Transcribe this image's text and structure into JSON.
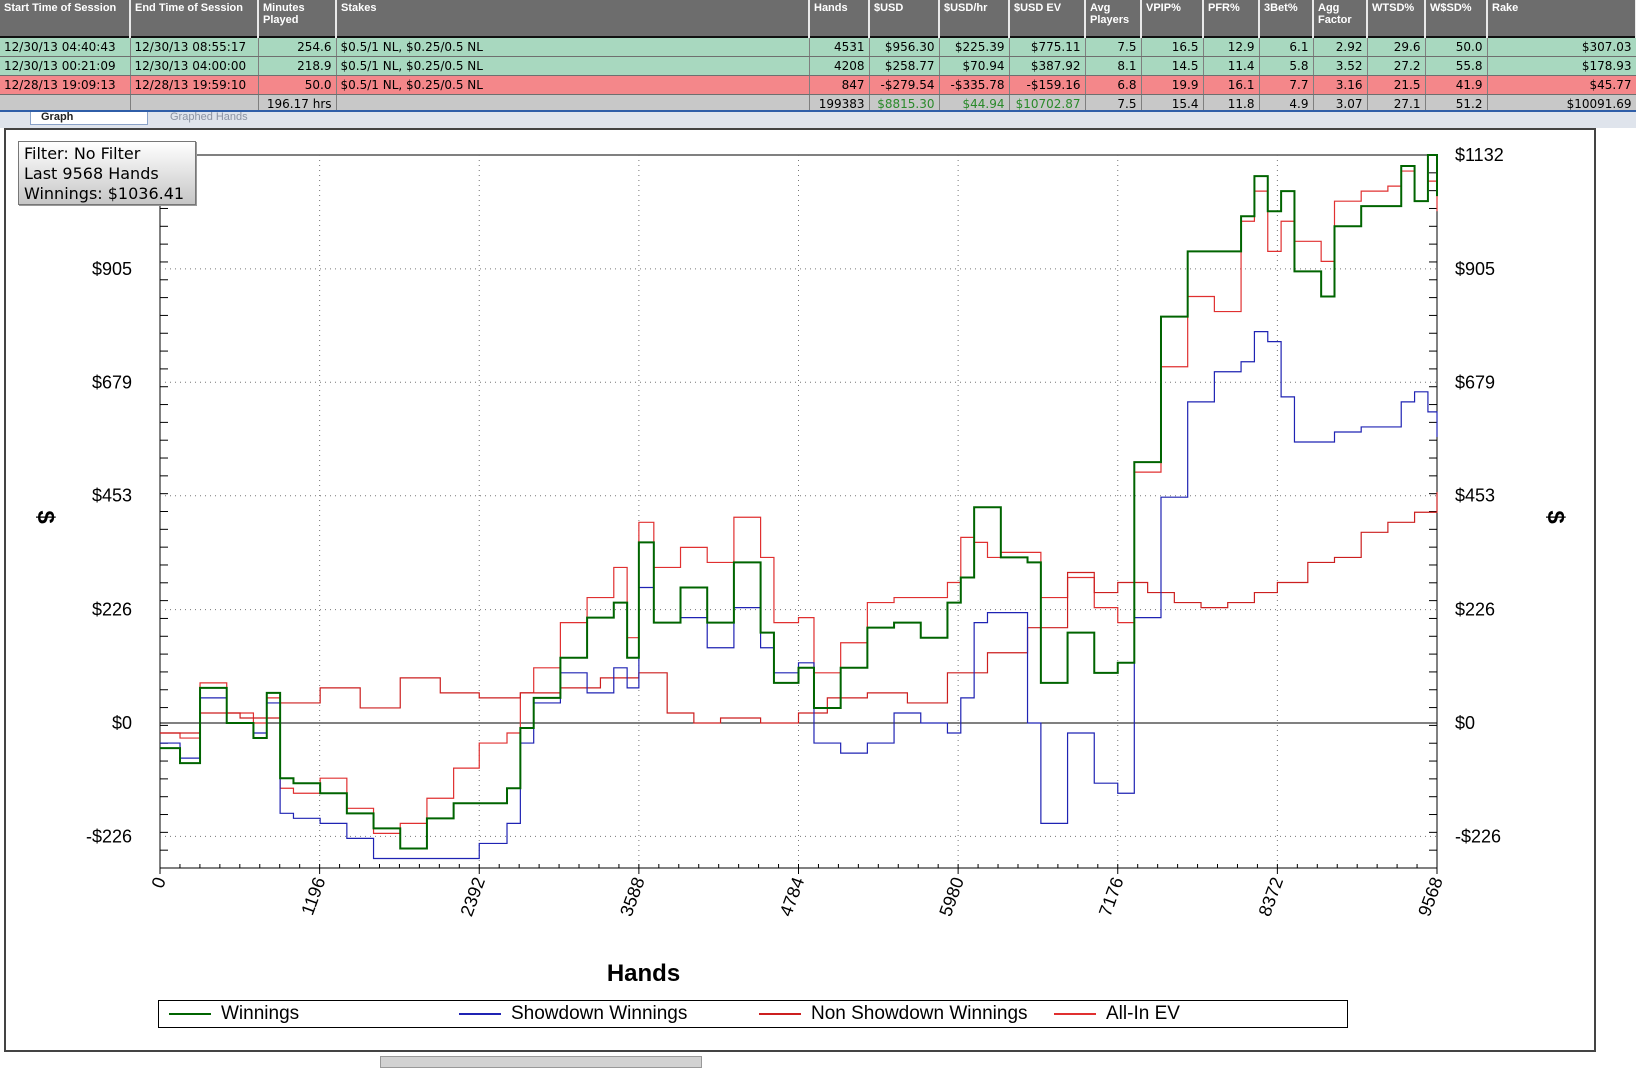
{
  "stats_table": {
    "columns": [
      "Start Time of Session",
      "End Time of Session",
      "Minutes Played",
      "Stakes",
      "Hands",
      "$USD",
      "$USD/hr",
      "$USD EV",
      "Avg Players",
      "VPIP%",
      "PFR%",
      "3Bet%",
      "Agg Factor",
      "WTSD%",
      "W$SD%",
      "Rake"
    ],
    "rows": [
      [
        "12/30/13 04:40:43",
        "12/30/13 08:55:17",
        "254.6",
        "$0.5/1 NL, $0.25/0.5 NL",
        "4531",
        "$956.30",
        "$225.39",
        "$775.11",
        "7.5",
        "16.5",
        "12.9",
        "6.1",
        "2.92",
        "29.6",
        "50.0",
        "$307.03"
      ],
      [
        "12/30/13 00:21:09",
        "12/30/13 04:00:00",
        "218.9",
        "$0.5/1 NL, $0.25/0.5 NL",
        "4208",
        "$258.77",
        "$70.94",
        "$387.92",
        "8.1",
        "14.5",
        "11.4",
        "5.8",
        "3.52",
        "27.2",
        "55.8",
        "$178.93"
      ],
      [
        "12/28/13 19:09:13",
        "12/28/13 19:59:10",
        "50.0",
        "$0.5/1 NL, $0.25/0.5 NL",
        "847",
        "-$279.54",
        "-$335.78",
        "-$159.16",
        "6.8",
        "19.9",
        "16.1",
        "7.7",
        "3.16",
        "21.5",
        "41.9",
        "$45.77"
      ],
      [
        "",
        "",
        "196.17 hrs",
        "",
        "199383",
        "$8815.30",
        "$44.94",
        "$10702.87",
        "7.5",
        "15.4",
        "11.8",
        "4.9",
        "3.07",
        "27.1",
        "51.2",
        "$10091.69"
      ]
    ],
    "row_styles": [
      "sel-green",
      "green",
      "red",
      "total"
    ]
  },
  "tabs": {
    "graph": "Graph",
    "graphed_hands": "Graphed Hands"
  },
  "filter": {
    "line1": "Filter: No Filter",
    "line2": "Last  9568 Hands",
    "line3": "Winnings: $1036.41"
  },
  "chart_data": {
    "type": "line",
    "xlabel": "Hands",
    "ylabel": "$",
    "x_ticks": [
      "0",
      "1196",
      "2392",
      "3588",
      "4784",
      "5980",
      "7176",
      "8372",
      "9568"
    ],
    "y_ticks": [
      "-$226",
      "$0",
      "$226",
      "$453",
      "$679",
      "$905",
      "$1132"
    ],
    "xlim": [
      0,
      9568
    ],
    "ylim": [
      -295,
      1132
    ],
    "grid": true,
    "legend_position": "bottom",
    "series": [
      {
        "name": "Winnings",
        "color": "#006400",
        "x": [
          0,
          150,
          300,
          500,
          700,
          800,
          900,
          1000,
          1200,
          1400,
          1600,
          1800,
          2000,
          2200,
          2392,
          2600,
          2700,
          2800,
          3000,
          3200,
          3400,
          3500,
          3588,
          3700,
          3900,
          4100,
          4300,
          4500,
          4600,
          4784,
          4900,
          5100,
          5300,
          5500,
          5700,
          5900,
          6000,
          6100,
          6200,
          6300,
          6500,
          6600,
          6800,
          7000,
          7176,
          7300,
          7500,
          7700,
          7900,
          8100,
          8200,
          8300,
          8400,
          8500,
          8700,
          8800,
          9000,
          9200,
          9300,
          9400,
          9500,
          9568
        ],
        "y": [
          -50,
          -80,
          70,
          0,
          -30,
          60,
          -110,
          -120,
          -140,
          -180,
          -210,
          -250,
          -190,
          -160,
          -160,
          -130,
          -10,
          50,
          130,
          210,
          240,
          130,
          360,
          200,
          270,
          200,
          320,
          180,
          80,
          110,
          30,
          110,
          190,
          200,
          170,
          240,
          290,
          430,
          430,
          330,
          320,
          80,
          180,
          100,
          120,
          520,
          810,
          940,
          940,
          1010,
          1090,
          1020,
          1060,
          900,
          850,
          990,
          1030,
          1030,
          1110,
          1040,
          1132,
          1050
        ]
      },
      {
        "name": "Showdown Winnings",
        "color": "#1f23b3",
        "x": [
          0,
          150,
          300,
          500,
          700,
          800,
          900,
          1000,
          1200,
          1400,
          1600,
          1800,
          2000,
          2200,
          2392,
          2600,
          2700,
          2800,
          3000,
          3200,
          3400,
          3500,
          3588,
          3700,
          3900,
          4100,
          4300,
          4500,
          4600,
          4784,
          4900,
          5100,
          5300,
          5500,
          5700,
          5900,
          6000,
          6100,
          6200,
          6300,
          6500,
          6600,
          6800,
          7000,
          7176,
          7300,
          7500,
          7700,
          7900,
          8100,
          8200,
          8300,
          8400,
          8500,
          8700,
          8800,
          9000,
          9200,
          9300,
          9400,
          9500,
          9568
        ],
        "y": [
          -40,
          -70,
          50,
          0,
          -20,
          40,
          -180,
          -190,
          -200,
          -230,
          -270,
          -270,
          -270,
          -270,
          -240,
          -200,
          -40,
          40,
          100,
          60,
          110,
          70,
          270,
          200,
          210,
          150,
          230,
          150,
          100,
          120,
          -40,
          -60,
          -40,
          20,
          0,
          -20,
          50,
          200,
          220,
          220,
          0,
          -200,
          -20,
          -120,
          -140,
          210,
          450,
          640,
          700,
          720,
          780,
          760,
          650,
          560,
          560,
          580,
          590,
          590,
          640,
          660,
          620,
          570
        ]
      },
      {
        "name": "Non Showdown Winnings",
        "color": "#cc1f1f",
        "x": [
          0,
          300,
          600,
          900,
          1200,
          1500,
          1800,
          2100,
          2392,
          2700,
          3000,
          3300,
          3588,
          3800,
          4000,
          4200,
          4500,
          4784,
          5000,
          5300,
          5600,
          5900,
          6200,
          6500,
          6800,
          7000,
          7176,
          7400,
          7600,
          7800,
          8000,
          8200,
          8372,
          8600,
          8800,
          9000,
          9200,
          9400,
          9568
        ],
        "y": [
          -20,
          20,
          10,
          40,
          70,
          30,
          90,
          60,
          50,
          60,
          70,
          90,
          100,
          20,
          0,
          10,
          0,
          20,
          50,
          60,
          40,
          100,
          140,
          190,
          300,
          260,
          280,
          260,
          240,
          230,
          240,
          260,
          280,
          320,
          330,
          380,
          400,
          420,
          460
        ]
      },
      {
        "name": "All-In EV",
        "color": "#e03030",
        "x": [
          0,
          150,
          300,
          500,
          700,
          800,
          900,
          1000,
          1200,
          1400,
          1600,
          1800,
          2000,
          2200,
          2392,
          2600,
          2700,
          2800,
          3000,
          3200,
          3400,
          3500,
          3588,
          3700,
          3900,
          4100,
          4300,
          4500,
          4600,
          4784,
          4900,
          5100,
          5300,
          5500,
          5700,
          5900,
          6000,
          6100,
          6200,
          6300,
          6500,
          6600,
          6800,
          7000,
          7176,
          7300,
          7500,
          7700,
          7900,
          8100,
          8200,
          8300,
          8400,
          8500,
          8700,
          8800,
          9000,
          9200,
          9300,
          9400,
          9500,
          9568
        ],
        "y": [
          -20,
          -30,
          80,
          20,
          0,
          50,
          -130,
          -140,
          -110,
          -170,
          -220,
          -200,
          -150,
          -90,
          -40,
          -20,
          60,
          110,
          200,
          250,
          310,
          170,
          400,
          310,
          350,
          320,
          410,
          330,
          200,
          210,
          100,
          160,
          240,
          250,
          250,
          280,
          370,
          360,
          330,
          340,
          340,
          250,
          290,
          230,
          200,
          500,
          710,
          850,
          820,
          1000,
          1060,
          940,
          1000,
          960,
          920,
          1040,
          1060,
          1070,
          1100,
          1040,
          1080,
          1020
        ]
      }
    ]
  },
  "legend": [
    "Winnings",
    "Showdown Winnings",
    "Non Showdown Winnings",
    "All-In EV"
  ]
}
